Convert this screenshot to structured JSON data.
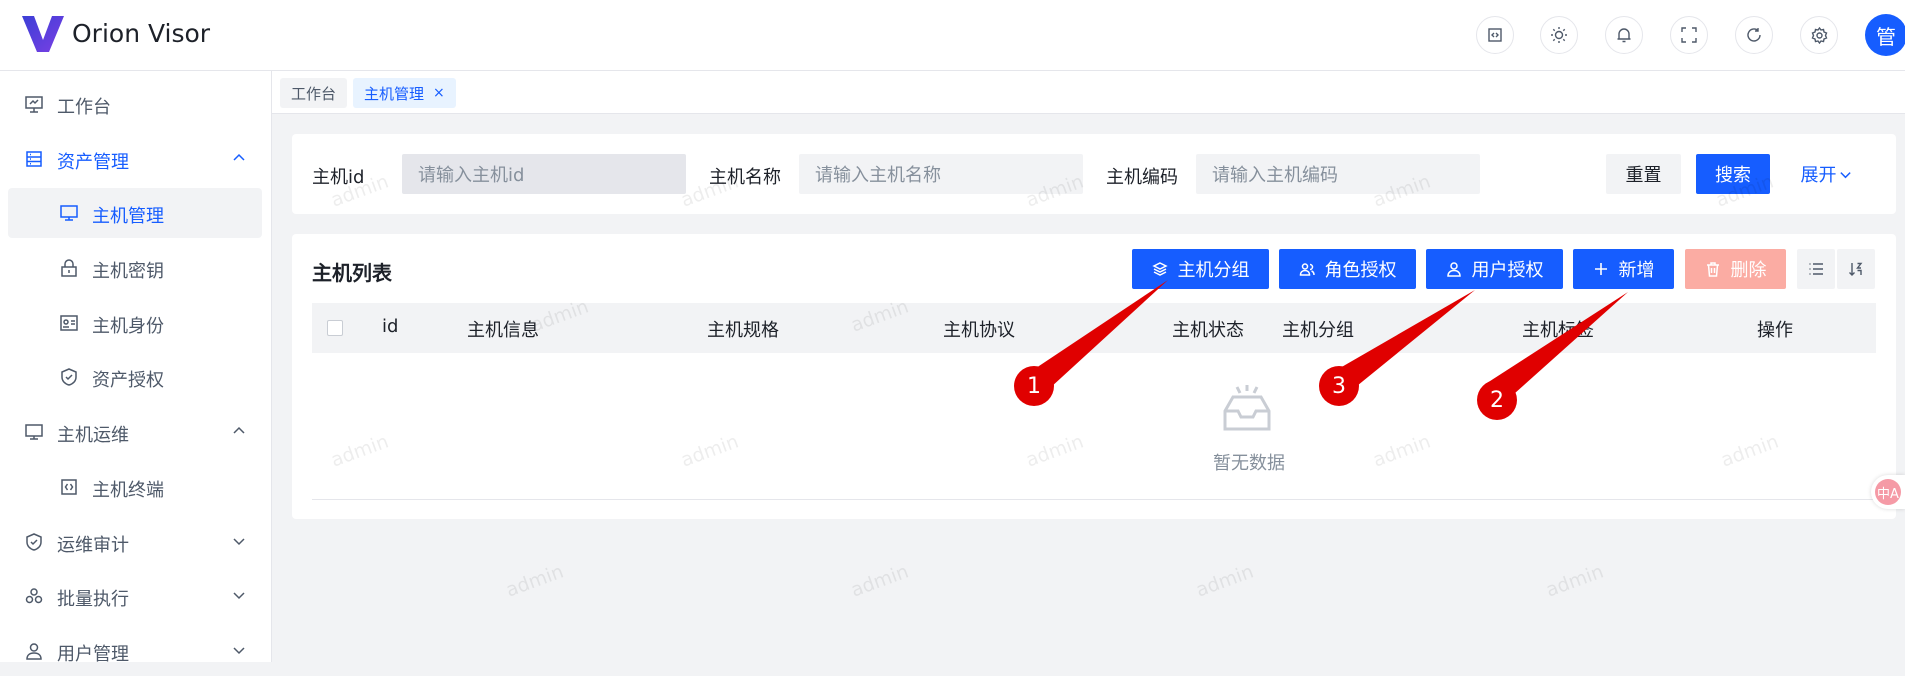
{
  "app": {
    "title": "Orion Visor",
    "avatar_text": "管"
  },
  "header_buttons": [
    "code-icon",
    "sun-icon",
    "bell-icon",
    "fullscreen-icon",
    "refresh-icon",
    "gear-icon"
  ],
  "sidebar": {
    "items": [
      {
        "label": "工作台",
        "icon": "dashboard-icon"
      },
      {
        "label": "资产管理",
        "icon": "asset-icon",
        "expanded": true
      },
      {
        "label": "主机管理",
        "icon": "monitor-icon",
        "active": true
      },
      {
        "label": "主机密钥",
        "icon": "lock-icon"
      },
      {
        "label": "主机身份",
        "icon": "id-card-icon"
      },
      {
        "label": "资产授权",
        "icon": "shield-icon"
      },
      {
        "label": "主机运维",
        "icon": "desktop-icon",
        "expanded": true
      },
      {
        "label": "主机终端",
        "icon": "code-icon"
      },
      {
        "label": "运维审计",
        "icon": "audit-shield-icon",
        "expanded": false
      },
      {
        "label": "批量执行",
        "icon": "batch-icon",
        "expanded": false
      },
      {
        "label": "用户管理",
        "icon": "user-icon",
        "expanded": false
      }
    ]
  },
  "tabs": [
    {
      "label": "工作台"
    },
    {
      "label": "主机管理",
      "active": true,
      "close": "×"
    }
  ],
  "search": {
    "fields": [
      {
        "label": "主机id",
        "placeholder": "请输入主机id"
      },
      {
        "label": "主机名称",
        "placeholder": "请输入主机名称"
      },
      {
        "label": "主机编码",
        "placeholder": "请输入主机编码"
      }
    ],
    "reset_label": "重置",
    "search_label": "搜索",
    "expand_label": "展开"
  },
  "list": {
    "title": "主机列表",
    "buttons": {
      "group": "主机分组",
      "role_auth": "角色授权",
      "user_auth": "用户授权",
      "add": "新增",
      "delete": "删除"
    },
    "columns": [
      "id",
      "主机信息",
      "主机规格",
      "主机协议",
      "主机状态",
      "主机分组",
      "主机标签",
      "操作"
    ],
    "empty_text": "暂无数据"
  },
  "annotations": [
    "1",
    "3",
    "2"
  ],
  "watermark_text": "admin",
  "translate_label": "中A",
  "colors": {
    "primary": "#165dff",
    "annotation": "#e00000",
    "danger_disabled": "#fbaca3"
  }
}
